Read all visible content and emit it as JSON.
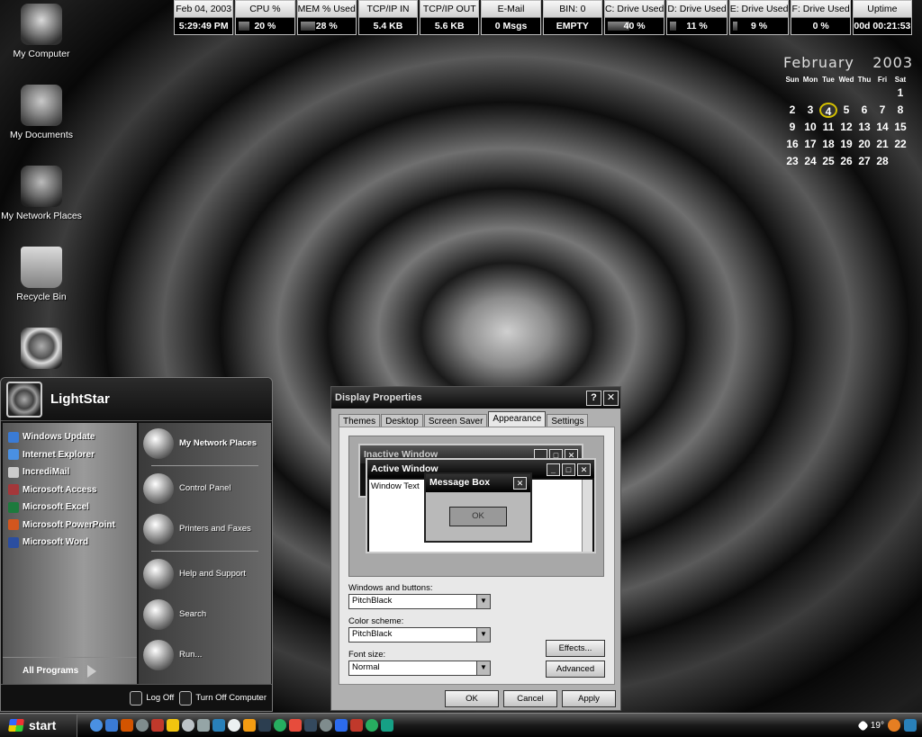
{
  "statusbar": [
    {
      "label": "Feb 04, 2003",
      "value": "5:29:49 PM",
      "meter": 0
    },
    {
      "label": "CPU %",
      "value": "20 %",
      "meter": 0.2
    },
    {
      "label": "MEM % Used",
      "value": "28 %",
      "meter": 0.28
    },
    {
      "label": "TCP/IP IN",
      "value": "5.4 KB",
      "meter": 0
    },
    {
      "label": "TCP/IP OUT",
      "value": "5.6 KB",
      "meter": 0
    },
    {
      "label": "E-Mail",
      "value": "0 Msgs",
      "meter": 0
    },
    {
      "label": "BIN: 0",
      "value": "EMPTY",
      "meter": 0
    },
    {
      "label": "C: Drive Used",
      "value": "40 %",
      "meter": 0.4
    },
    {
      "label": "D: Drive Used",
      "value": "11 %",
      "meter": 0.11
    },
    {
      "label": "E: Drive Used",
      "value": "9 %",
      "meter": 0.09
    },
    {
      "label": "F: Drive Used",
      "value": "0 %",
      "meter": 0
    },
    {
      "label": "Uptime",
      "value": "00d 00:21:53",
      "meter": 0
    }
  ],
  "calendar": {
    "month": "February",
    "year": "2003",
    "day_names": [
      "Sun",
      "Mon",
      "Tue",
      "Wed",
      "Thu",
      "Fri",
      "Sat"
    ],
    "first_weekday": 6,
    "days": 28,
    "today": 4
  },
  "desktop_icons": [
    {
      "label": "My Computer",
      "icon": "computer-icon"
    },
    {
      "label": "My Documents",
      "icon": "documents-icon"
    },
    {
      "label": "My Network Places",
      "icon": "network-icon"
    },
    {
      "label": "Recycle Bin",
      "icon": "recycle-bin-icon"
    },
    {
      "label": "",
      "icon": "internet-explorer-icon"
    }
  ],
  "start_menu": {
    "user": "LightStar",
    "left_items": [
      {
        "label": "Windows Update",
        "icon": "windows-update-icon",
        "color": "#3a7bd5"
      },
      {
        "label": "Internet Explorer",
        "icon": "ie-icon",
        "color": "#4a90e2"
      },
      {
        "label": "IncrediMail",
        "icon": "incredimail-icon",
        "color": "#cccccc"
      },
      {
        "label": "Microsoft Access",
        "icon": "access-icon",
        "color": "#a4373a"
      },
      {
        "label": "Microsoft Excel",
        "icon": "excel-icon",
        "color": "#1d7a3d"
      },
      {
        "label": "Microsoft PowerPoint",
        "icon": "powerpoint-icon",
        "color": "#d2561e"
      },
      {
        "label": "Microsoft Word",
        "icon": "word-icon",
        "color": "#2b4ea0"
      }
    ],
    "all_programs": "All Programs",
    "right_items": [
      {
        "label": "My Network Places",
        "icon": "network-places-icon",
        "bold": true
      },
      {
        "label": "Control Panel",
        "icon": "control-panel-icon",
        "bold": false
      },
      {
        "label": "Printers and Faxes",
        "icon": "printer-icon",
        "bold": false
      },
      {
        "label": "Help and Support",
        "icon": "help-icon",
        "bold": false
      },
      {
        "label": "Search",
        "icon": "search-icon",
        "bold": false
      },
      {
        "label": "Run...",
        "icon": "run-icon",
        "bold": false
      }
    ],
    "log_off": "Log Off",
    "turn_off": "Turn Off Computer"
  },
  "dialog": {
    "title": "Display Properties",
    "tabs": [
      "Themes",
      "Desktop",
      "Screen Saver",
      "Appearance",
      "Settings"
    ],
    "active_tab": 3,
    "preview": {
      "inactive_title": "Inactive Window",
      "active_title": "Active Window",
      "window_text": "Window Text",
      "message_title": "Message Box",
      "ok": "OK"
    },
    "windows_buttons_label": "Windows and buttons:",
    "windows_buttons_value": "PitchBlack",
    "color_scheme_label": "Color scheme:",
    "color_scheme_value": "PitchBlack",
    "font_size_label": "Font size:",
    "font_size_value": "Normal",
    "effects": "Effects...",
    "advanced": "Advanced",
    "ok": "OK",
    "cancel": "Cancel",
    "apply": "Apply"
  },
  "taskbar": {
    "start": "start",
    "quicklaunch": [
      "#4a90e2",
      "#3a7bd5",
      "#d35400",
      "#7f8c8d",
      "#c0392b",
      "#f1c40f",
      "#bdc3c7",
      "#95a5a6",
      "#2980b9",
      "#ecf0f1",
      "#f39c12",
      "#2c3e50",
      "#27ae60",
      "#e74c3c",
      "#34495e",
      "#7f8c8d",
      "#2c6bed",
      "#c0392b",
      "#27ae60",
      "#16a085"
    ],
    "temperature": "19°",
    "tray_colors": [
      "#ffffff",
      "#e67e22",
      "#2980b9"
    ]
  }
}
